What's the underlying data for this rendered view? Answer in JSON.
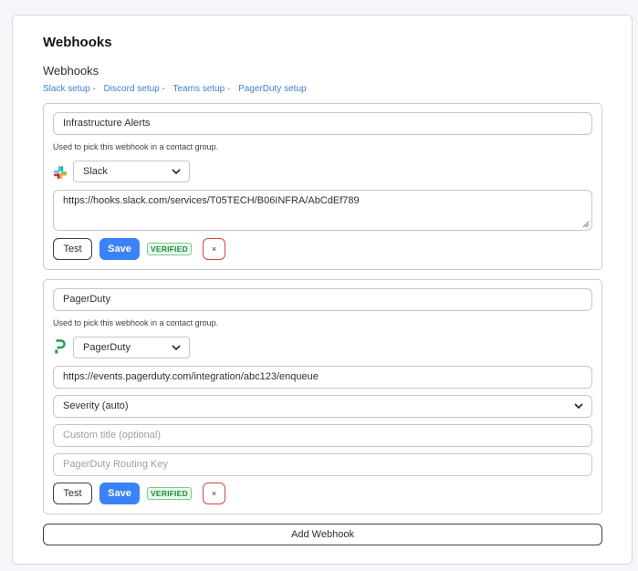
{
  "section": {
    "title": "Webhooks",
    "subtitle": "Webhooks"
  },
  "setup_links": [
    {
      "label": "Slack setup",
      "sep": "-"
    },
    {
      "label": "Discord setup",
      "sep": "-"
    },
    {
      "label": "Teams setup",
      "sep": "-"
    },
    {
      "label": "PagerDuty setup",
      "sep": ""
    }
  ],
  "webhooks": [
    {
      "name": "Infrastructure Alerts",
      "hint": "Used to pick this webhook in a contact group.",
      "type": "Slack",
      "type_icon": "slack-icon",
      "url": "https://hooks.slack.com/services/T05TECH/B06INFRA/AbCdEf789",
      "test_label": "Test",
      "save_label": "Save",
      "status_badge": "VERIFIED",
      "delete_label": "×"
    },
    {
      "name": "PagerDuty",
      "hint": "Used to pick this webhook in a contact group.",
      "type": "PagerDuty",
      "type_icon": "pagerduty-icon",
      "url": "https://events.pagerduty.com/integration/abc123/enqueue",
      "severity": "Severity (auto)",
      "custom_title_placeholder": "Custom title (optional)",
      "routing_key_placeholder": "PagerDuty Routing Key",
      "test_label": "Test",
      "save_label": "Save",
      "status_badge": "VERIFIED",
      "delete_label": "×"
    }
  ],
  "add_button_label": "Add Webhook",
  "colors": {
    "accent": "#3b82f6",
    "link": "#3d7fd1",
    "verified_text": "#1f8a3c",
    "verified_bg": "#e9f8ed",
    "delete_border": "#d24545",
    "pagerduty_green": "#17a04a"
  }
}
